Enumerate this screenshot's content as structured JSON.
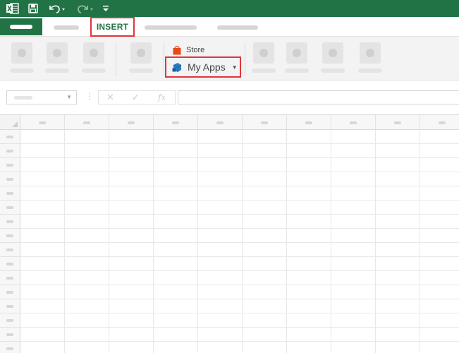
{
  "quick_access": {
    "app_icon": "excel-logo-icon",
    "save_icon": "save-icon",
    "undo_icon": "undo-icon",
    "redo_icon": "redo-icon",
    "customize_icon": "customize-toolbar-icon"
  },
  "tabs": {
    "active_label": "INSERT"
  },
  "ribbon": {
    "store_label": "Store",
    "my_apps_label": "My Apps",
    "store_icon": "store-bag-icon",
    "my_apps_icon": "my-apps-icon"
  },
  "formula_bar": {
    "fx_label": "fx"
  },
  "colors": {
    "brand_green": "#217346",
    "highlight_red": "#e0353b",
    "store_orange": "#e64a19",
    "apps_blue": "#2a7fc0"
  }
}
